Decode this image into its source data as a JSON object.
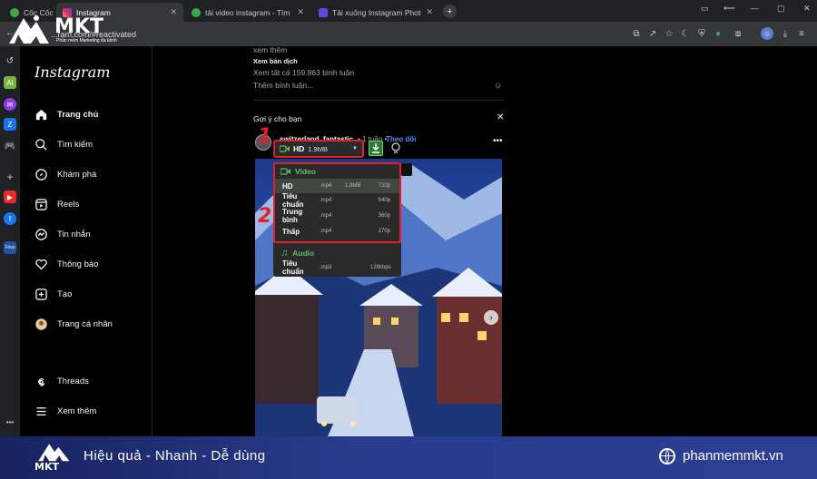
{
  "browser": {
    "brand": "Cốc Cốc",
    "tabs": [
      {
        "title": "Instagram"
      },
      {
        "title": "tải video instagram - Tìm với Cốc Cốc"
      },
      {
        "title": "Tải xuống Instagram Photos, Video, ..."
      }
    ],
    "url": "...ram.com/#reactivated",
    "new_tab": "+"
  },
  "logo": {
    "name": "MKT",
    "tagline": "Phần mềm Marketing đa kênh"
  },
  "instagram": {
    "logo": "Instagram",
    "nav": [
      {
        "label": "Trang chủ",
        "icon": "home-icon"
      },
      {
        "label": "Tìm kiếm",
        "icon": "search-icon"
      },
      {
        "label": "Khám phá",
        "icon": "compass-icon"
      },
      {
        "label": "Reels",
        "icon": "reels-icon"
      },
      {
        "label": "Tin nhắn",
        "icon": "messenger-icon"
      },
      {
        "label": "Thông báo",
        "icon": "heart-icon"
      },
      {
        "label": "Tạo",
        "icon": "plus-square-icon"
      },
      {
        "label": "Trang cá nhân",
        "icon": "avatar"
      }
    ],
    "threads": "Threads",
    "more": "Xem thêm"
  },
  "feed": {
    "see_more": "xem thêm",
    "see_translation": "Xem bản dịch",
    "view_all_comments": "Xem tất cả 159.863 bình luận",
    "add_comment": "Thêm bình luận...",
    "suggest_title": "Gợi ý cho bạn",
    "post_user": "switzerland_fantastic",
    "post_time": "• 1 tuần •",
    "follow": "Theo dõi"
  },
  "downloader": {
    "selected": "HD",
    "selected_size": "1.9MB",
    "video_label": "Video",
    "audio_label": "Audio",
    "video_rows": [
      {
        "quality": "HD",
        "format": ".mp4",
        "size": "1.9MB",
        "res": "720p"
      },
      {
        "quality": "Tiêu chuẩn",
        "format": ".mp4",
        "size": "",
        "res": "540p"
      },
      {
        "quality": "Trung bình",
        "format": ".mp4",
        "size": "",
        "res": "360p"
      },
      {
        "quality": "Thấp",
        "format": ".mp4",
        "size": "",
        "res": "270p"
      }
    ],
    "audio_rows": [
      {
        "quality": "Tiêu chuẩn",
        "format": ".mp3",
        "size": "",
        "res": "128kbps"
      }
    ],
    "step1": "1",
    "step2": "2"
  },
  "banner": {
    "slogan": "Hiệu quả - Nhanh - Dễ dùng",
    "website": "phanmemmkt.vn"
  },
  "colors": {
    "accent": "#e3202a",
    "green": "#5fbf60",
    "banner": "#2a3c8e"
  }
}
